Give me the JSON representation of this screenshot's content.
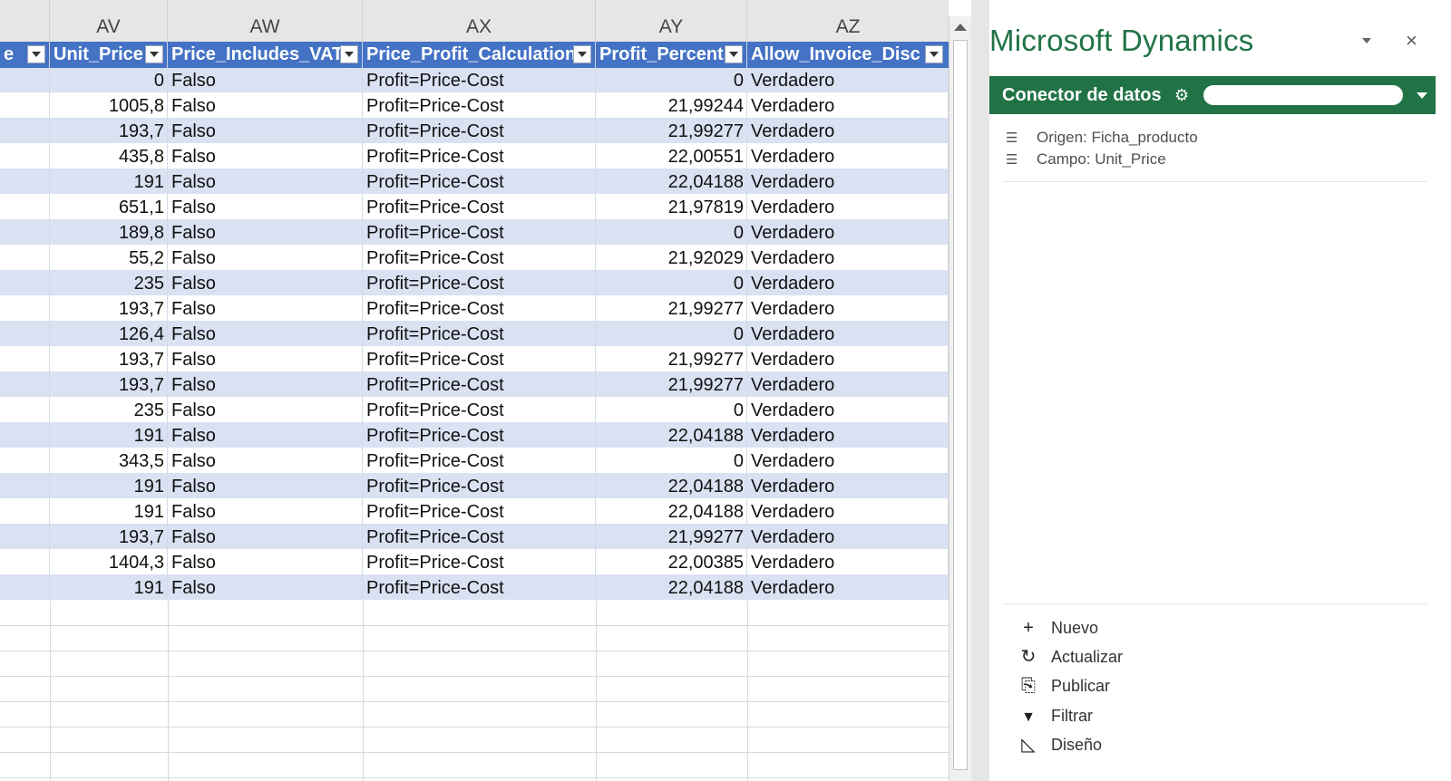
{
  "sheet": {
    "column_letters": [
      "AV",
      "AW",
      "AX",
      "AY",
      "AZ"
    ],
    "headers": [
      "e",
      "Unit_Price",
      "Price_Includes_VAT",
      "Price_Profit_Calculation",
      "Profit_Percent",
      "Allow_Invoice_Disc"
    ],
    "rows": [
      [
        "0",
        "Falso",
        "Profit=Price-Cost",
        "0",
        "Verdadero"
      ],
      [
        "1005,8",
        "Falso",
        "Profit=Price-Cost",
        "21,99244",
        "Verdadero"
      ],
      [
        "193,7",
        "Falso",
        "Profit=Price-Cost",
        "21,99277",
        "Verdadero"
      ],
      [
        "435,8",
        "Falso",
        "Profit=Price-Cost",
        "22,00551",
        "Verdadero"
      ],
      [
        "191",
        "Falso",
        "Profit=Price-Cost",
        "22,04188",
        "Verdadero"
      ],
      [
        "651,1",
        "Falso",
        "Profit=Price-Cost",
        "21,97819",
        "Verdadero"
      ],
      [
        "189,8",
        "Falso",
        "Profit=Price-Cost",
        "0",
        "Verdadero"
      ],
      [
        "55,2",
        "Falso",
        "Profit=Price-Cost",
        "21,92029",
        "Verdadero"
      ],
      [
        "235",
        "Falso",
        "Profit=Price-Cost",
        "0",
        "Verdadero"
      ],
      [
        "193,7",
        "Falso",
        "Profit=Price-Cost",
        "21,99277",
        "Verdadero"
      ],
      [
        "126,4",
        "Falso",
        "Profit=Price-Cost",
        "0",
        "Verdadero"
      ],
      [
        "193,7",
        "Falso",
        "Profit=Price-Cost",
        "21,99277",
        "Verdadero"
      ],
      [
        "193,7",
        "Falso",
        "Profit=Price-Cost",
        "21,99277",
        "Verdadero"
      ],
      [
        "235",
        "Falso",
        "Profit=Price-Cost",
        "0",
        "Verdadero"
      ],
      [
        "191",
        "Falso",
        "Profit=Price-Cost",
        "22,04188",
        "Verdadero"
      ],
      [
        "343,5",
        "Falso",
        "Profit=Price-Cost",
        "0",
        "Verdadero"
      ],
      [
        "191",
        "Falso",
        "Profit=Price-Cost",
        "22,04188",
        "Verdadero"
      ],
      [
        "191",
        "Falso",
        "Profit=Price-Cost",
        "22,04188",
        "Verdadero"
      ],
      [
        "193,7",
        "Falso",
        "Profit=Price-Cost",
        "21,99277",
        "Verdadero"
      ],
      [
        "1404,3",
        "Falso",
        "Profit=Price-Cost",
        "22,00385",
        "Verdadero"
      ],
      [
        "191",
        "Falso",
        "Profit=Price-Cost",
        "22,04188",
        "Verdadero"
      ]
    ],
    "table_header_color": "#4472c4",
    "band_color": "#d9e1f2"
  },
  "pane": {
    "title": "Microsoft Dynamics",
    "menu_icon": "chevron-down-icon",
    "close_label": "×",
    "connector": {
      "label": "Conector de datos",
      "gear_icon": "gear-icon",
      "gear_glyph": "⚙",
      "accent": "#217346"
    },
    "info": {
      "origin": "Origen: Ficha_producto",
      "field": "Campo: Unit_Price"
    },
    "actions": [
      {
        "label": "Nuevo",
        "icon": "plus-icon",
        "glyph": "+"
      },
      {
        "label": "Actualizar",
        "icon": "refresh-icon",
        "glyph": "↻"
      },
      {
        "label": "Publicar",
        "icon": "publish-icon",
        "glyph": "⎘"
      },
      {
        "label": "Filtrar",
        "icon": "filter-icon",
        "glyph": "▼"
      },
      {
        "label": "Diseño",
        "icon": "design-icon",
        "glyph": "◺"
      }
    ]
  }
}
